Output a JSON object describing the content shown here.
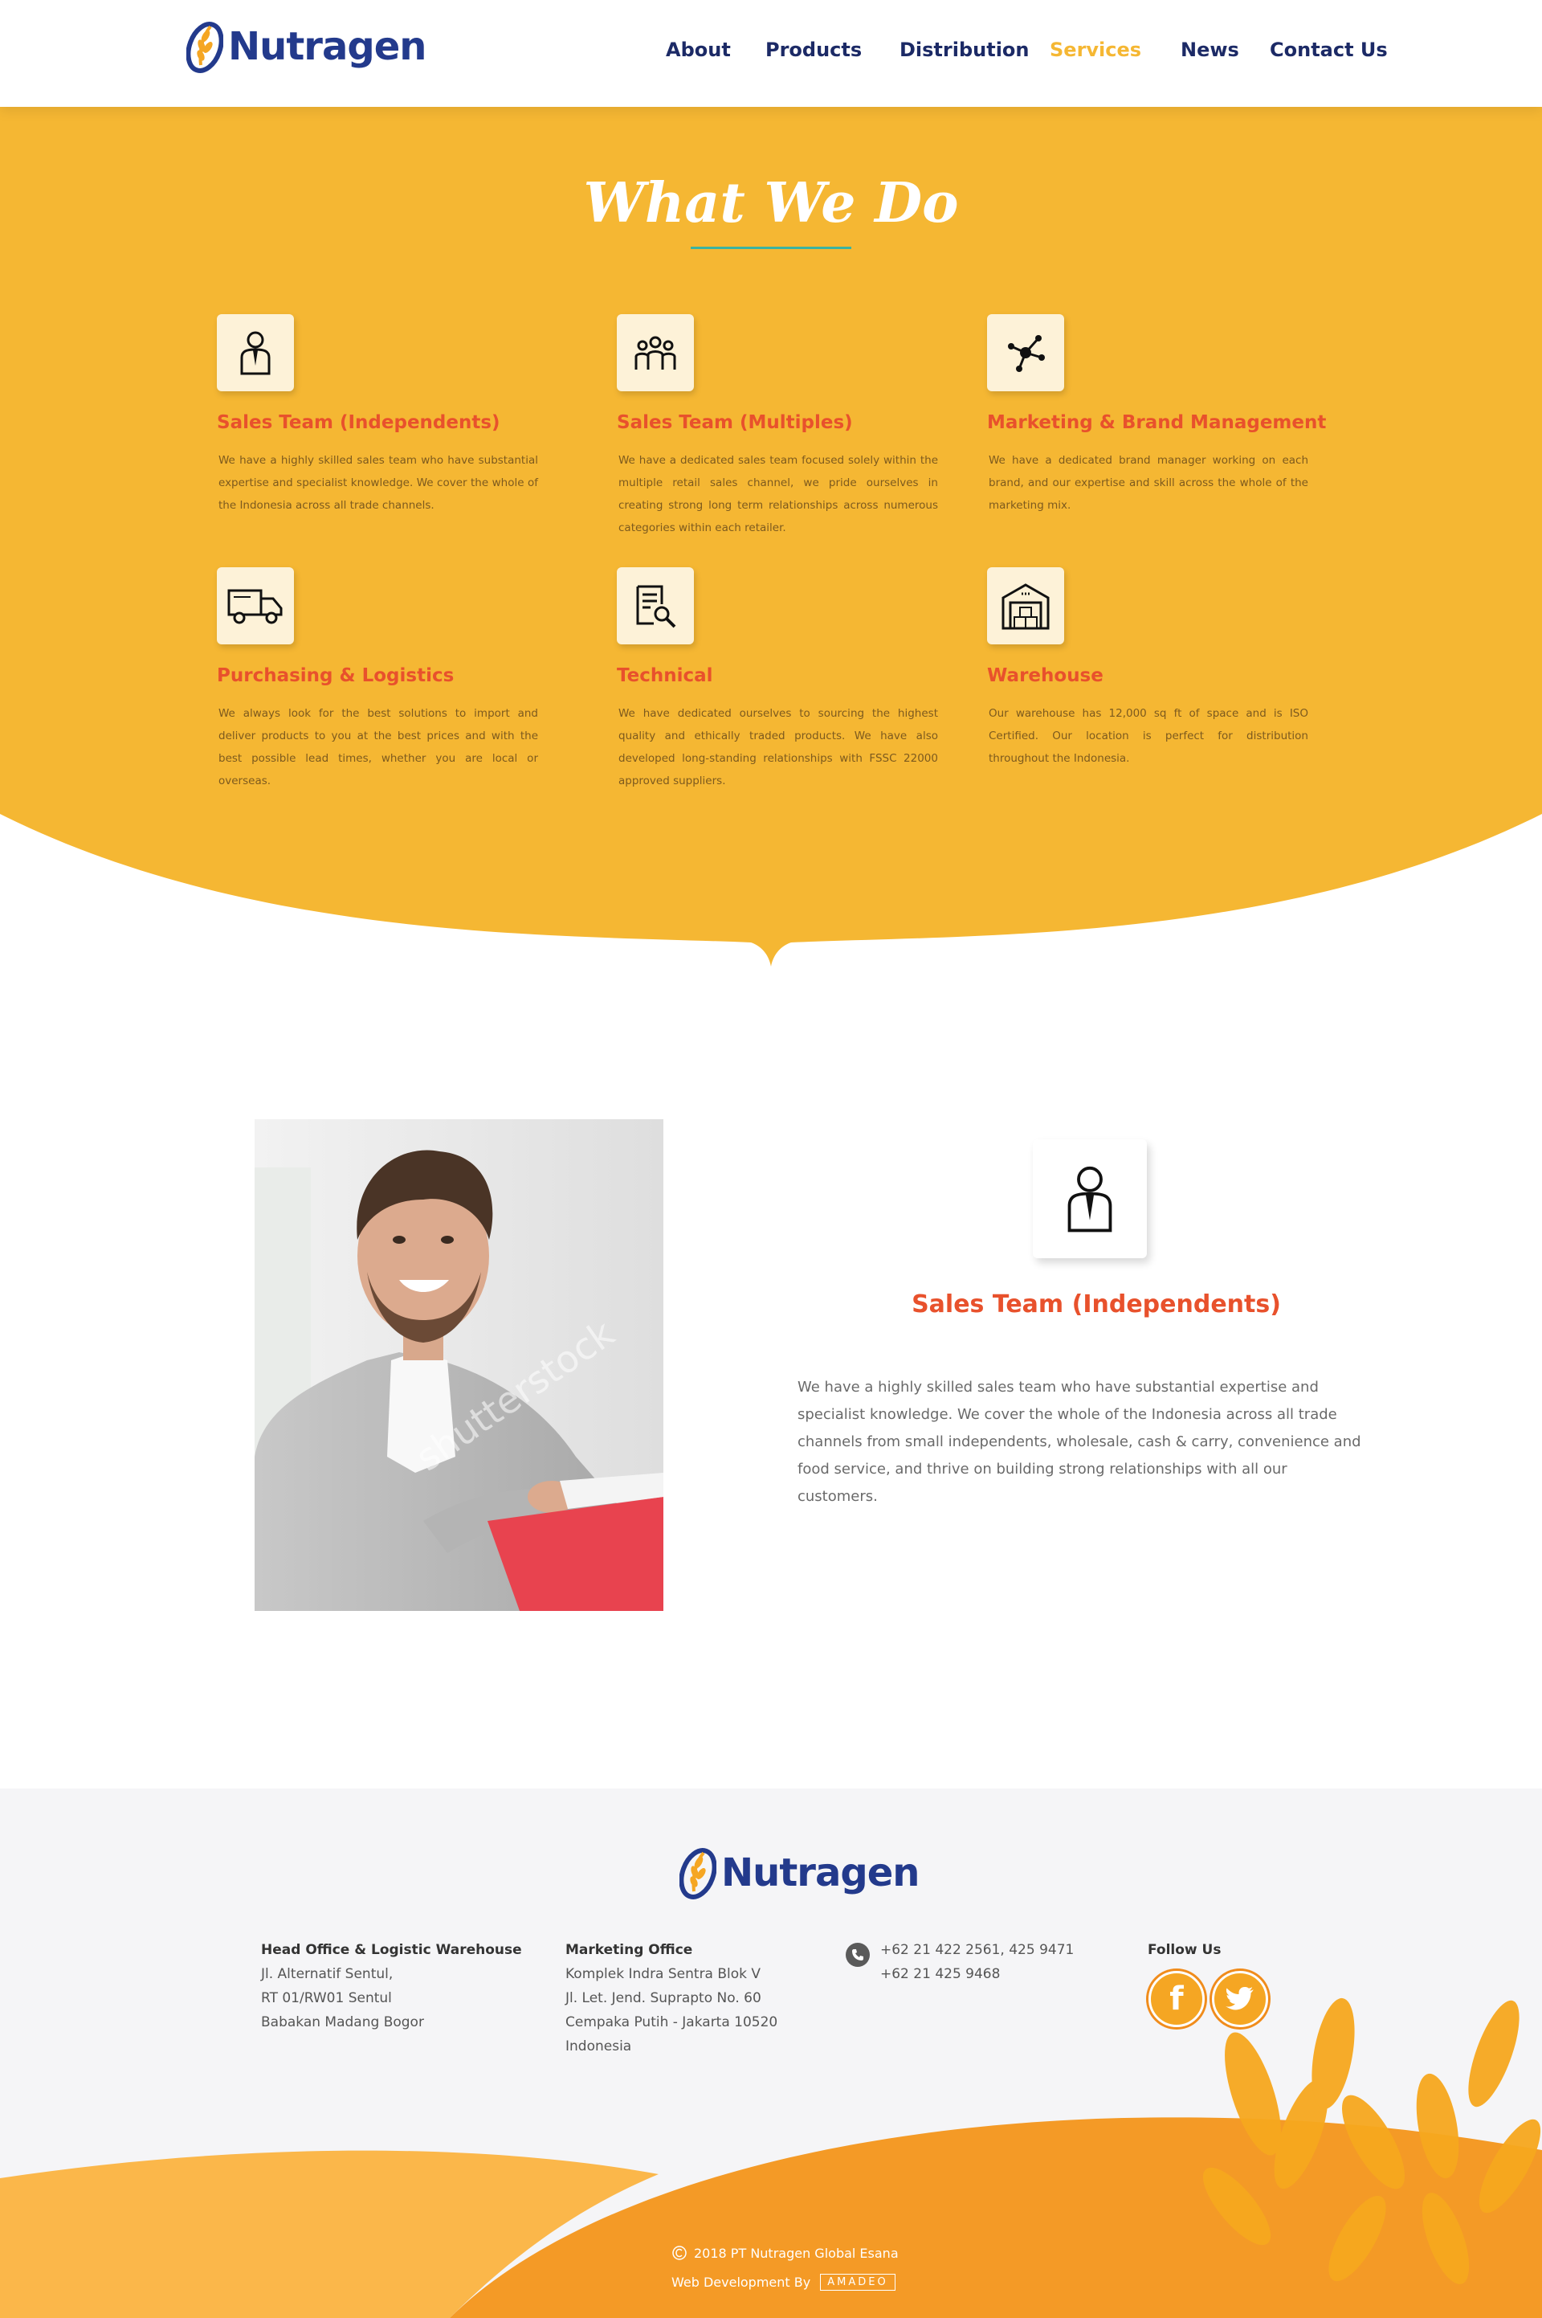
{
  "brand": {
    "name": "Nutragen",
    "primary": "#233a8c",
    "accent": "#f5b733",
    "orange": "#f4b632",
    "title_red": "#e8512c"
  },
  "nav": {
    "items": [
      {
        "label": "About",
        "active": false
      },
      {
        "label": "Products",
        "active": false
      },
      {
        "label": "Distribution",
        "active": false
      },
      {
        "label": "Services",
        "active": true
      },
      {
        "label": "News",
        "active": false
      },
      {
        "label": "Contact Us",
        "active": false
      }
    ]
  },
  "what_we_do": {
    "title": "What We Do",
    "services": [
      {
        "icon": "businessman-icon",
        "title": "Sales Team (Independents)",
        "desc": "We have a highly skilled sales team who have substantial expertise and specialist knowledge.  We cover the whole of the Indonesia across all trade channels."
      },
      {
        "icon": "team-icon",
        "title": "Sales Team (Multiples)",
        "desc": "We have a dedicated sales team focused solely within the multiple retail sales channel, we pride ourselves in creating strong long term relationships across numerous categories within each retailer."
      },
      {
        "icon": "network-icon",
        "title": "Marketing & Brand Management",
        "desc": "We have a dedicated brand manager working on each brand, and our expertise and skill across the whole of the marketing mix."
      },
      {
        "icon": "truck-icon",
        "title": "Purchasing & Logistics",
        "desc": "We always look for the best solutions to import and deliver products to you at the best prices and with the best possible lead times, whether you are local or overseas."
      },
      {
        "icon": "document-search-icon",
        "title": "Technical",
        "desc": "We have dedicated ourselves to sourcing the highest quality and ethically traded products. We have also developed long-standing relationships with FSSC 22000 approved suppliers."
      },
      {
        "icon": "warehouse-icon",
        "title": "Warehouse",
        "desc": "Our warehouse has 12,000 sq ft of space and is ISO Certified. Our location is perfect for distribution throughout the Indonesia."
      }
    ]
  },
  "detail": {
    "photo_watermark": "shutterstock",
    "title": "Sales Team (Independents)",
    "desc": "We have a highly skilled sales team who have substantial expertise and specialist knowledge.  We cover the whole of the Indonesia across all trade channels from small independents, wholesale, cash & carry, convenience and food service, and thrive on building strong relationships with all our customers."
  },
  "footer": {
    "head_office": {
      "heading": "Head Office & Logistic Warehouse",
      "lines": [
        "Jl. Alternatif Sentul,",
        "RT 01/RW01 Sentul",
        "Babakan Madang Bogor"
      ]
    },
    "marketing_office": {
      "heading": "Marketing Office",
      "lines": [
        "Komplek Indra Sentra Blok V",
        "Jl. Let. Jend. Suprapto No. 60",
        "Cempaka Putih - Jakarta 10520",
        "Indonesia"
      ]
    },
    "phones": [
      "+62 21 422 2561, 425 9471",
      "+62 21 425 9468"
    ],
    "follow_label": "Follow Us",
    "copyright": "2018 PT Nutragen Global Esana",
    "webdev_label": "Web Development By",
    "webdev_brand": "AMADEO"
  }
}
